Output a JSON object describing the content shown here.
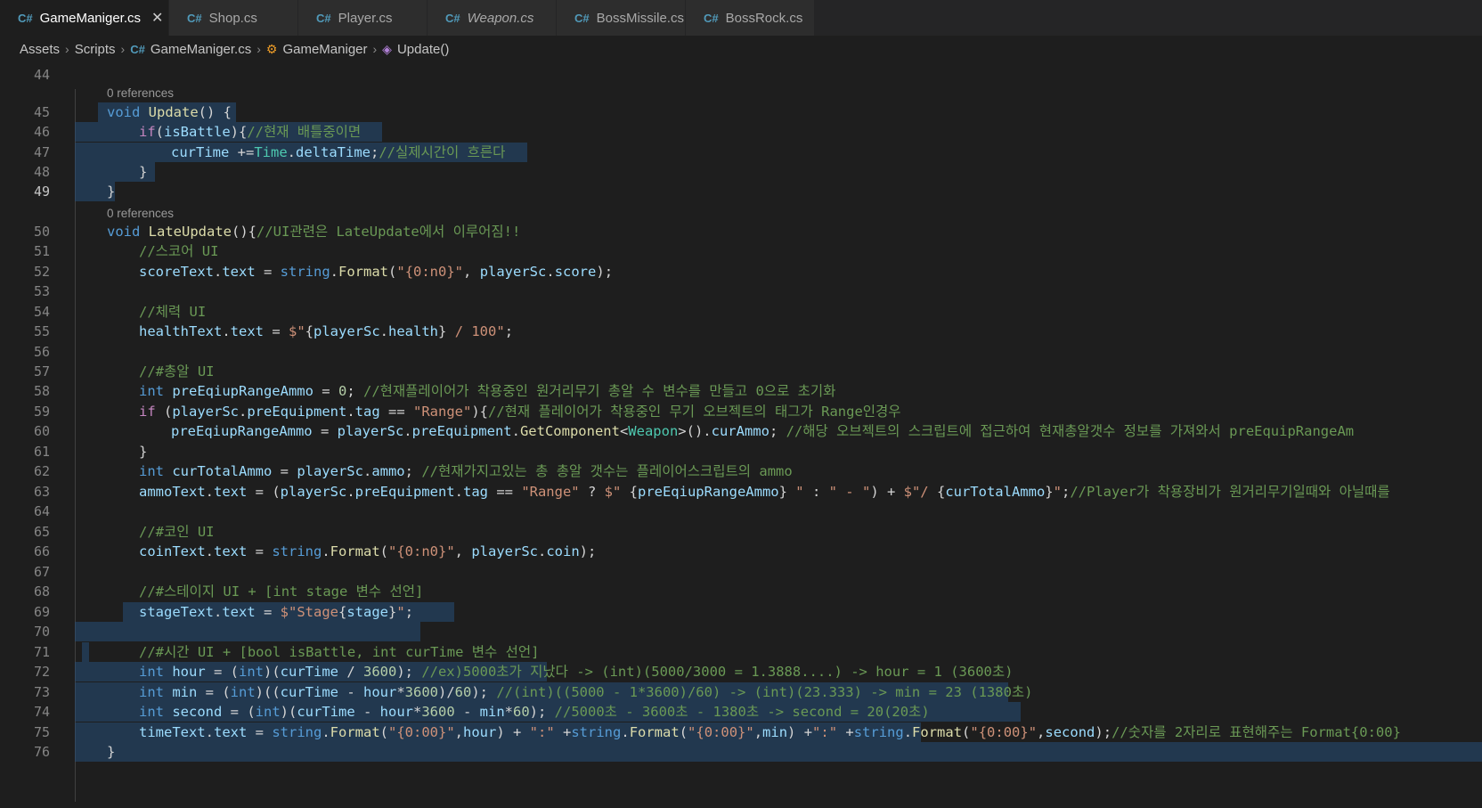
{
  "tabs": [
    {
      "title": "GameManiger.cs",
      "active": true,
      "italic": false,
      "state": "close"
    },
    {
      "title": "Shop.cs",
      "active": false,
      "italic": false,
      "state": "none"
    },
    {
      "title": "Player.cs",
      "active": false,
      "italic": false,
      "state": "none"
    },
    {
      "title": "Weapon.cs",
      "active": false,
      "italic": true,
      "state": "none"
    },
    {
      "title": "BossMissile.cs",
      "active": false,
      "italic": false,
      "state": "modified"
    },
    {
      "title": "BossRock.cs",
      "active": false,
      "italic": false,
      "state": "modified"
    }
  ],
  "icons": {
    "tab_file": "csharp-file-icon",
    "tab_close": "close-icon",
    "tab_modified": "modified-dot-icon",
    "class": "class-icon",
    "method": "method-icon",
    "separator": "chevron-right-icon"
  },
  "breadcrumb": {
    "assets": "Assets",
    "scripts": "Scripts",
    "file": "GameManiger.cs",
    "class": "GameManiger",
    "method": "Update()"
  },
  "colors": {
    "background": "#1e1e1e",
    "keyword": "#569cd6",
    "type": "#4ec9b0",
    "function": "#dcdcaa",
    "identifier": "#9cdcfe",
    "string": "#ce9178",
    "number": "#b5cea8",
    "comment": "#6a9955",
    "selection": "#264f78",
    "csharp_icon": "#519aba"
  },
  "editor": {
    "references_label": "0 references",
    "lines": [
      {
        "n": "44",
        "t": []
      },
      {
        "n": "45",
        "t": [
          [
            "kw",
            "void "
          ],
          [
            "fn",
            "Update"
          ],
          [
            "p",
            "() {"
          ]
        ]
      },
      {
        "n": "46",
        "t": [
          [
            "ctl",
            "if"
          ],
          [
            "p",
            "("
          ],
          [
            "id",
            "isBattle"
          ],
          [
            "p",
            "){"
          ],
          [
            "cm",
            "//현재 배틀중이면"
          ]
        ]
      },
      {
        "n": "47",
        "t": [
          [
            "id",
            "curTime"
          ],
          [
            "p",
            " +="
          ],
          [
            "ty",
            "Time"
          ],
          [
            "p",
            "."
          ],
          [
            "id",
            "deltaTime"
          ],
          [
            "p",
            ";"
          ],
          [
            "cm",
            "//실제시간이 흐른다"
          ]
        ]
      },
      {
        "n": "48",
        "t": [
          [
            "p",
            "}"
          ]
        ]
      },
      {
        "n": "49",
        "t": [
          [
            "p",
            "}"
          ]
        ]
      },
      {
        "n": "50",
        "t": [
          [
            "kw",
            "void "
          ],
          [
            "fn",
            "LateUpdate"
          ],
          [
            "p",
            "(){"
          ],
          [
            "cm",
            "//UI관련은 LateUpdate에서 이루어짐!!"
          ]
        ]
      },
      {
        "n": "51",
        "t": [
          [
            "cm",
            "//스코어 UI"
          ]
        ]
      },
      {
        "n": "52",
        "t": [
          [
            "id",
            "scoreText"
          ],
          [
            "p",
            "."
          ],
          [
            "id",
            "text"
          ],
          [
            "p",
            " = "
          ],
          [
            "kw",
            "string"
          ],
          [
            "p",
            "."
          ],
          [
            "fn",
            "Format"
          ],
          [
            "p",
            "("
          ],
          [
            "st",
            "\"{0:n0}\""
          ],
          [
            "p",
            ", "
          ],
          [
            "id",
            "playerSc"
          ],
          [
            "p",
            "."
          ],
          [
            "id",
            "score"
          ],
          [
            "p",
            ");"
          ]
        ]
      },
      {
        "n": "53",
        "t": []
      },
      {
        "n": "54",
        "t": [
          [
            "cm",
            "//체력 UI"
          ]
        ]
      },
      {
        "n": "55",
        "t": [
          [
            "id",
            "healthText"
          ],
          [
            "p",
            "."
          ],
          [
            "id",
            "text"
          ],
          [
            "p",
            " = "
          ],
          [
            "st",
            "$\""
          ],
          [
            "p",
            "{"
          ],
          [
            "id",
            "playerSc"
          ],
          [
            "p",
            "."
          ],
          [
            "id",
            "health"
          ],
          [
            "p",
            "}"
          ],
          [
            "st",
            " / 100\""
          ],
          [
            "p",
            ";"
          ]
        ]
      },
      {
        "n": "56",
        "t": []
      },
      {
        "n": "57",
        "t": [
          [
            "cm",
            "//#총알 UI"
          ]
        ]
      },
      {
        "n": "58",
        "t": [
          [
            "kw",
            "int "
          ],
          [
            "id",
            "preEqiupRangeAmmo"
          ],
          [
            "p",
            " = "
          ],
          [
            "nu",
            "0"
          ],
          [
            "p",
            "; "
          ],
          [
            "cm",
            "//현재플레이어가 착용중인 원거리무기 총알 수 변수를 만들고 0으로 초기화"
          ]
        ]
      },
      {
        "n": "59",
        "t": [
          [
            "ctl",
            "if"
          ],
          [
            "p",
            " ("
          ],
          [
            "id",
            "playerSc"
          ],
          [
            "p",
            "."
          ],
          [
            "id",
            "preEquipment"
          ],
          [
            "p",
            "."
          ],
          [
            "id",
            "tag"
          ],
          [
            "p",
            " == "
          ],
          [
            "st",
            "\"Range\""
          ],
          [
            "p",
            "){"
          ],
          [
            "cm",
            "//현재 플레이어가 착용중인 무기 오브젝트의 태그가 Range인경우"
          ]
        ]
      },
      {
        "n": "60",
        "t": [
          [
            "id",
            "preEqiupRangeAmmo"
          ],
          [
            "p",
            " = "
          ],
          [
            "id",
            "playerSc"
          ],
          [
            "p",
            "."
          ],
          [
            "id",
            "preEquipment"
          ],
          [
            "p",
            "."
          ],
          [
            "fn",
            "GetComponent"
          ],
          [
            "p",
            "<"
          ],
          [
            "ty",
            "Weapon"
          ],
          [
            "p",
            ">()."
          ],
          [
            "id",
            "curAmmo"
          ],
          [
            "p",
            "; "
          ],
          [
            "cm",
            "//해당 오브젝트의 스크립트에 접근하여 현재총알갯수 정보를 가져와서 preEquipRangeAm"
          ]
        ]
      },
      {
        "n": "61",
        "t": [
          [
            "p",
            "}"
          ]
        ]
      },
      {
        "n": "62",
        "t": [
          [
            "kw",
            "int "
          ],
          [
            "id",
            "curTotalAmmo"
          ],
          [
            "p",
            " = "
          ],
          [
            "id",
            "playerSc"
          ],
          [
            "p",
            "."
          ],
          [
            "id",
            "ammo"
          ],
          [
            "p",
            "; "
          ],
          [
            "cm",
            "//현재가지고있는 총 총알 갯수는 플레이어스크립트의 ammo"
          ]
        ]
      },
      {
        "n": "63",
        "t": [
          [
            "id",
            "ammoText"
          ],
          [
            "p",
            "."
          ],
          [
            "id",
            "text"
          ],
          [
            "p",
            " = ("
          ],
          [
            "id",
            "playerSc"
          ],
          [
            "p",
            "."
          ],
          [
            "id",
            "preEquipment"
          ],
          [
            "p",
            "."
          ],
          [
            "id",
            "tag"
          ],
          [
            "p",
            " == "
          ],
          [
            "st",
            "\"Range\""
          ],
          [
            "p",
            " ? "
          ],
          [
            "st",
            "$\" "
          ],
          [
            "p",
            "{"
          ],
          [
            "id",
            "preEqiupRangeAmmo"
          ],
          [
            "p",
            "}"
          ],
          [
            "st",
            " \""
          ],
          [
            "p",
            " : "
          ],
          [
            "st",
            "\" - \""
          ],
          [
            "p",
            ") + "
          ],
          [
            "st",
            "$\"/ "
          ],
          [
            "p",
            "{"
          ],
          [
            "id",
            "curTotalAmmo"
          ],
          [
            "p",
            "}"
          ],
          [
            "st",
            "\""
          ],
          [
            "p",
            ";"
          ],
          [
            "cm",
            "//Player가 착용장비가 원거리무기일때와 아닐때를"
          ]
        ]
      },
      {
        "n": "64",
        "t": []
      },
      {
        "n": "65",
        "t": [
          [
            "cm",
            "//#코인 UI"
          ]
        ]
      },
      {
        "n": "66",
        "t": [
          [
            "id",
            "coinText"
          ],
          [
            "p",
            "."
          ],
          [
            "id",
            "text"
          ],
          [
            "p",
            " = "
          ],
          [
            "kw",
            "string"
          ],
          [
            "p",
            "."
          ],
          [
            "fn",
            "Format"
          ],
          [
            "p",
            "("
          ],
          [
            "st",
            "\"{0:n0}\""
          ],
          [
            "p",
            ", "
          ],
          [
            "id",
            "playerSc"
          ],
          [
            "p",
            "."
          ],
          [
            "id",
            "coin"
          ],
          [
            "p",
            ");"
          ]
        ]
      },
      {
        "n": "67",
        "t": []
      },
      {
        "n": "68",
        "t": [
          [
            "cm",
            "//#스테이지 UI + [int stage 변수 선언]"
          ]
        ]
      },
      {
        "n": "69",
        "t": [
          [
            "id",
            "stageText"
          ],
          [
            "p",
            "."
          ],
          [
            "id",
            "text"
          ],
          [
            "p",
            " = "
          ],
          [
            "st",
            "$\"Stage"
          ],
          [
            "p",
            "{"
          ],
          [
            "id",
            "stage"
          ],
          [
            "p",
            "}"
          ],
          [
            "st",
            "\""
          ],
          [
            "p",
            ";"
          ]
        ]
      },
      {
        "n": "70",
        "t": []
      },
      {
        "n": "71",
        "t": [
          [
            "cm",
            "//#시간 UI + [bool isBattle, int curTime 변수 선언]"
          ]
        ]
      },
      {
        "n": "72",
        "t": [
          [
            "kw",
            "int "
          ],
          [
            "id",
            "hour"
          ],
          [
            "p",
            " = ("
          ],
          [
            "kw",
            "int"
          ],
          [
            "p",
            ")("
          ],
          [
            "id",
            "curTime"
          ],
          [
            "p",
            " / "
          ],
          [
            "nu",
            "3600"
          ],
          [
            "p",
            "); "
          ],
          [
            "cm",
            "//ex)5000초가 지났다 -> (int)(5000/3000 = 1.3888....) -> hour = 1 (3600초)"
          ]
        ]
      },
      {
        "n": "73",
        "t": [
          [
            "kw",
            "int "
          ],
          [
            "id",
            "min"
          ],
          [
            "p",
            " = ("
          ],
          [
            "kw",
            "int"
          ],
          [
            "p",
            ")(("
          ],
          [
            "id",
            "curTime"
          ],
          [
            "p",
            " - "
          ],
          [
            "id",
            "hour"
          ],
          [
            "p",
            "*"
          ],
          [
            "nu",
            "3600"
          ],
          [
            "p",
            ")/"
          ],
          [
            "nu",
            "60"
          ],
          [
            "p",
            "); "
          ],
          [
            "cm",
            "//(int)((5000 - 1*3600)/60) -> (int)(23.333) -> min = 23 (1380초)"
          ]
        ]
      },
      {
        "n": "74",
        "t": [
          [
            "kw",
            "int "
          ],
          [
            "id",
            "second"
          ],
          [
            "p",
            " = ("
          ],
          [
            "kw",
            "int"
          ],
          [
            "p",
            ")("
          ],
          [
            "id",
            "curTime"
          ],
          [
            "p",
            " - "
          ],
          [
            "id",
            "hour"
          ],
          [
            "p",
            "*"
          ],
          [
            "nu",
            "3600"
          ],
          [
            "p",
            " - "
          ],
          [
            "id",
            "min"
          ],
          [
            "p",
            "*"
          ],
          [
            "nu",
            "60"
          ],
          [
            "p",
            "); "
          ],
          [
            "cm",
            "//5000초 - 3600초 - 1380초 -> second = 20(20초)"
          ]
        ]
      },
      {
        "n": "75",
        "t": [
          [
            "id",
            "timeText"
          ],
          [
            "p",
            "."
          ],
          [
            "id",
            "text"
          ],
          [
            "p",
            " = "
          ],
          [
            "kw",
            "string"
          ],
          [
            "p",
            "."
          ],
          [
            "fn",
            "Format"
          ],
          [
            "p",
            "("
          ],
          [
            "st",
            "\"{0:00}\""
          ],
          [
            "p",
            ","
          ],
          [
            "id",
            "hour"
          ],
          [
            "p",
            ") + "
          ],
          [
            "st",
            "\":\""
          ],
          [
            "p",
            " +"
          ],
          [
            "kw",
            "string"
          ],
          [
            "p",
            "."
          ],
          [
            "fn",
            "Format"
          ],
          [
            "p",
            "("
          ],
          [
            "st",
            "\"{0:00}\""
          ],
          [
            "p",
            ","
          ],
          [
            "id",
            "min"
          ],
          [
            "p",
            ") +"
          ],
          [
            "st",
            "\":\""
          ],
          [
            "p",
            " +"
          ],
          [
            "kw",
            "string"
          ],
          [
            "p",
            "."
          ],
          [
            "fn",
            "Format"
          ],
          [
            "p",
            "("
          ],
          [
            "st",
            "\"{0:00}\""
          ],
          [
            "p",
            ","
          ],
          [
            "id",
            "second"
          ],
          [
            "p",
            ");"
          ],
          [
            "cm",
            "//숫자를 2자리로 표현해주는 Format{0:00}"
          ]
        ]
      },
      {
        "n": "76",
        "t": [
          [
            "p",
            "}"
          ]
        ]
      }
    ]
  }
}
